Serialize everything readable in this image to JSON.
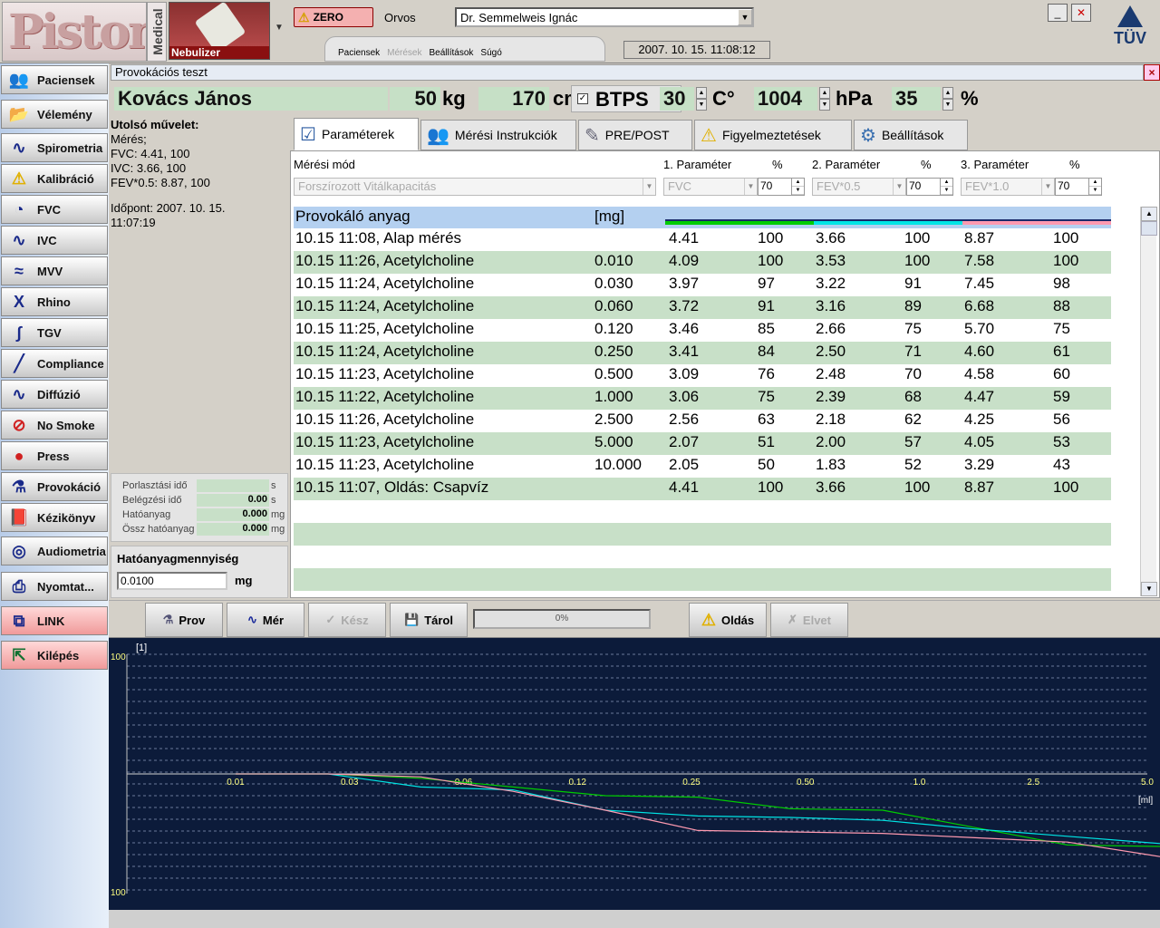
{
  "header": {
    "logo_text": "Piston",
    "medical_text": "Medical",
    "nebulizer_label": "Nebulizer",
    "zero_label": "ZERO",
    "doctor_label": "Orvos",
    "doctor_value": "Dr. Semmelweis Ignác",
    "menu": [
      "Paciensek",
      "Mérések",
      "Beállítások",
      "Súgó"
    ],
    "datetime": "2007. 10. 15. 11:08:12",
    "tuv_label": "TÜV"
  },
  "sidebar": {
    "items": [
      {
        "label": "Paciensek",
        "icon": "patients-icon"
      },
      {
        "label": "Vélemény",
        "icon": "folder-icon"
      },
      {
        "label": "Spirometria",
        "icon": "wave-icon"
      },
      {
        "label": "Kalibráció",
        "icon": "warning-icon"
      },
      {
        "label": "FVC",
        "icon": "fvc-loop-icon"
      },
      {
        "label": "IVC",
        "icon": "wave-icon"
      },
      {
        "label": "MVV",
        "icon": "mvv-icon"
      },
      {
        "label": "Rhino",
        "icon": "rhino-icon"
      },
      {
        "label": "TGV",
        "icon": "tgv-icon"
      },
      {
        "label": "Compliance",
        "icon": "compliance-icon"
      },
      {
        "label": "Diffúzió",
        "icon": "diffusion-icon"
      },
      {
        "label": "No Smoke",
        "icon": "no-smoke-icon"
      },
      {
        "label": "Press",
        "icon": "balloon-icon"
      },
      {
        "label": "Provokáció",
        "icon": "nebulizer-icon"
      },
      {
        "label": "Kézikönyv",
        "icon": "manual-icon"
      },
      {
        "label": "Audiometria",
        "icon": "headphones-icon"
      },
      {
        "label": "Nyomtat...",
        "icon": "printer-icon"
      },
      {
        "label": "LINK",
        "icon": "link-icon"
      },
      {
        "label": "Kilépés",
        "icon": "exit-icon"
      }
    ]
  },
  "window": {
    "title": "Provokációs teszt"
  },
  "patient": {
    "name": "Kovács János",
    "weight": "50",
    "weight_unit": "kg",
    "height": "170",
    "height_unit": "cm",
    "btps_label": "BTPS",
    "temp": "30",
    "temp_unit": "C°",
    "pressure": "1004",
    "pressure_unit": "hPa",
    "humidity": "35",
    "humidity_unit": "%"
  },
  "last_op": {
    "title": "Utolsó művelet:",
    "line1": "Mérés;",
    "line2": "FVC: 4.41, 100",
    "line3": "IVC: 3.66, 100",
    "line4": "FEV*0.5: 8.87, 100",
    "time_label": "Időpont: 2007. 10. 15.",
    "time_value": "11:07:19"
  },
  "nebu_stats": [
    {
      "label": "Porlasztási idő",
      "value": "",
      "unit": "s"
    },
    {
      "label": "Belégzési idő",
      "value": "0.00",
      "unit": "s"
    },
    {
      "label": "Hatóanyag",
      "value": "0.000",
      "unit": "mg"
    },
    {
      "label": "Össz hatóanyag",
      "value": "0.000",
      "unit": "mg"
    }
  ],
  "dose": {
    "title": "Hatóanyagmennyiség",
    "value": "0.0100",
    "unit": "mg"
  },
  "tabs": [
    {
      "label": "Paraméterek",
      "icon": "checklist-icon"
    },
    {
      "label": "Mérési Instrukciók",
      "icon": "people-icon"
    },
    {
      "label": "PRE/POST",
      "icon": "syringe-icon"
    },
    {
      "label": "Figyelmeztetések",
      "icon": "warning-icon"
    },
    {
      "label": "Beállítások",
      "icon": "settings-icon"
    }
  ],
  "params": {
    "mode_label": "Mérési mód",
    "mode_value": "Forszírozott Vitálkapacitás",
    "p1_label": "1. Paraméter",
    "p2_label": "2. Paraméter",
    "p3_label": "3. Paraméter",
    "pct_label": "%",
    "p1_value": "FVC",
    "p2_value": "FEV*0.5",
    "p3_value": "FEV*1.0",
    "p1_pct": "70",
    "p2_pct": "70",
    "p3_pct": "70"
  },
  "table": {
    "header_substance": "Provokáló anyag",
    "header_mg": "[mg]",
    "series_colors": [
      "#00cc00",
      "#00e5e5",
      "#ff9ab0"
    ],
    "rows": [
      {
        "name": "10.15 11:08, Alap mérés",
        "mg": "",
        "v1": "4.41",
        "p1": "100",
        "v2": "3.66",
        "p2": "100",
        "v3": "8.87",
        "p3": "100"
      },
      {
        "name": "10.15 11:26, Acetylcholine",
        "mg": "0.010",
        "v1": "4.09",
        "p1": "100",
        "v2": "3.53",
        "p2": "100",
        "v3": "7.58",
        "p3": "100"
      },
      {
        "name": "10.15 11:24, Acetylcholine",
        "mg": "0.030",
        "v1": "3.97",
        "p1": "97",
        "v2": "3.22",
        "p2": "91",
        "v3": "7.45",
        "p3": "98"
      },
      {
        "name": "10.15 11:24, Acetylcholine",
        "mg": "0.060",
        "v1": "3.72",
        "p1": "91",
        "v2": "3.16",
        "p2": "89",
        "v3": "6.68",
        "p3": "88"
      },
      {
        "name": "10.15 11:25, Acetylcholine",
        "mg": "0.120",
        "v1": "3.46",
        "p1": "85",
        "v2": "2.66",
        "p2": "75",
        "v3": "5.70",
        "p3": "75"
      },
      {
        "name": "10.15 11:24, Acetylcholine",
        "mg": "0.250",
        "v1": "3.41",
        "p1": "84",
        "v2": "2.50",
        "p2": "71",
        "v3": "4.60",
        "p3": "61"
      },
      {
        "name": "10.15 11:23, Acetylcholine",
        "mg": "0.500",
        "v1": "3.09",
        "p1": "76",
        "v2": "2.48",
        "p2": "70",
        "v3": "4.58",
        "p3": "60"
      },
      {
        "name": "10.15 11:22, Acetylcholine",
        "mg": "1.000",
        "v1": "3.06",
        "p1": "75",
        "v2": "2.39",
        "p2": "68",
        "v3": "4.47",
        "p3": "59"
      },
      {
        "name": "10.15 11:26, Acetylcholine",
        "mg": "2.500",
        "v1": "2.56",
        "p1": "63",
        "v2": "2.18",
        "p2": "62",
        "v3": "4.25",
        "p3": "56"
      },
      {
        "name": "10.15 11:23, Acetylcholine",
        "mg": "5.000",
        "v1": "2.07",
        "p1": "51",
        "v2": "2.00",
        "p2": "57",
        "v3": "4.05",
        "p3": "53"
      },
      {
        "name": "10.15 11:23, Acetylcholine",
        "mg": "10.000",
        "v1": "2.05",
        "p1": "50",
        "v2": "1.83",
        "p2": "52",
        "v3": "3.29",
        "p3": "43"
      },
      {
        "name": "10.15 11:07, Oldás: Csapvíz",
        "mg": "",
        "v1": "4.41",
        "p1": "100",
        "v2": "3.66",
        "p2": "100",
        "v3": "8.87",
        "p3": "100"
      }
    ]
  },
  "toolbar": {
    "prov": "Prov",
    "mer": "Mér",
    "kesz": "Kész",
    "tarol": "Tárol",
    "progress": "0%",
    "oldas": "Oldás",
    "elvet": "Elvet"
  },
  "chart_data": {
    "type": "line",
    "ylabel": "[1]",
    "xlabel": "[ml]",
    "y_ticks": [
      "100",
      "100"
    ],
    "x_ticks": [
      "0.01",
      "0.03",
      "0.06",
      "0.12",
      "0.25",
      "0.50",
      "1.0",
      "2.5",
      "5.0"
    ],
    "background": "#0c1b3a",
    "series": [
      {
        "color": "#00cc00",
        "values": [
          100,
          100,
          97,
          91,
          85,
          84,
          76,
          75,
          63,
          51,
          50
        ]
      },
      {
        "color": "#00e5e5",
        "values": [
          100,
          100,
          91,
          89,
          75,
          71,
          70,
          68,
          62,
          57,
          52
        ]
      },
      {
        "color": "#ff9ab0",
        "values": [
          100,
          100,
          98,
          88,
          75,
          61,
          60,
          59,
          56,
          53,
          43
        ]
      }
    ]
  }
}
